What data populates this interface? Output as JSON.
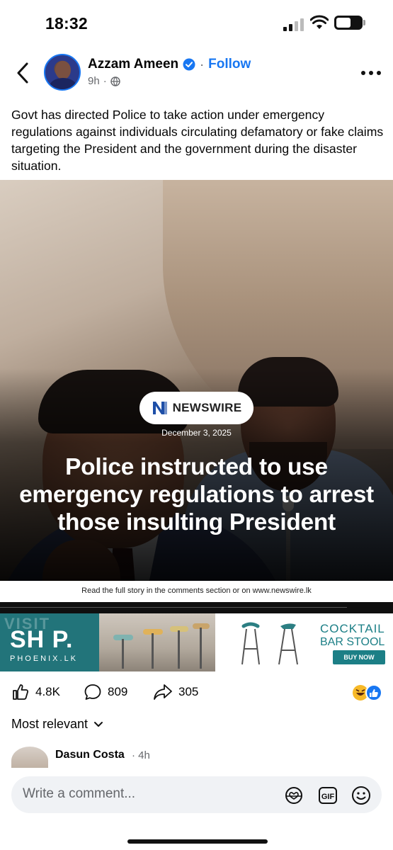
{
  "status_bar": {
    "time": "18:32",
    "battery": "56"
  },
  "post": {
    "author": "Azzam Ameen",
    "follow_label": "Follow",
    "dot": "·",
    "time_ago": "9h",
    "time_dot": "·",
    "text": "Govt has directed Police to take action under emergency regulations against individuals circulating defamatory or fake claims targeting the President and the government during the disaster situation."
  },
  "image": {
    "brand": "NEWSWIRE",
    "date": "December 3, 2025",
    "headline": "Police instructed to use emergency regulations to arrest those insulting President",
    "caption": "Read the full story in the comments section or on www.newswire.lk"
  },
  "ad": {
    "visit": "VISIT",
    "shop": "SH P.",
    "phoenix": "PHOENIX.LK",
    "cocktail": "COCKTAIL",
    "barstool": "BAR STOOL",
    "buy_now": "BUY NOW"
  },
  "reactions": {
    "likes": "4.8K",
    "comments": "809",
    "shares": "305"
  },
  "sort": {
    "label": "Most relevant"
  },
  "comment_preview": {
    "name": "Dasun Costa",
    "time": "· 4h"
  },
  "composer": {
    "placeholder": "Write a comment..."
  },
  "colors": {
    "accent": "#1877f2",
    "ad_teal": "#22747a",
    "text_secondary": "#65676b"
  },
  "icons": [
    "back-icon",
    "verified-icon",
    "globe-icon",
    "more-icon",
    "like-icon",
    "comment-icon",
    "share-icon",
    "reaction-haha-icon",
    "reaction-like-icon",
    "chevron-down-icon",
    "avatar-sticker-icon",
    "gif-icon",
    "emoji-icon"
  ]
}
